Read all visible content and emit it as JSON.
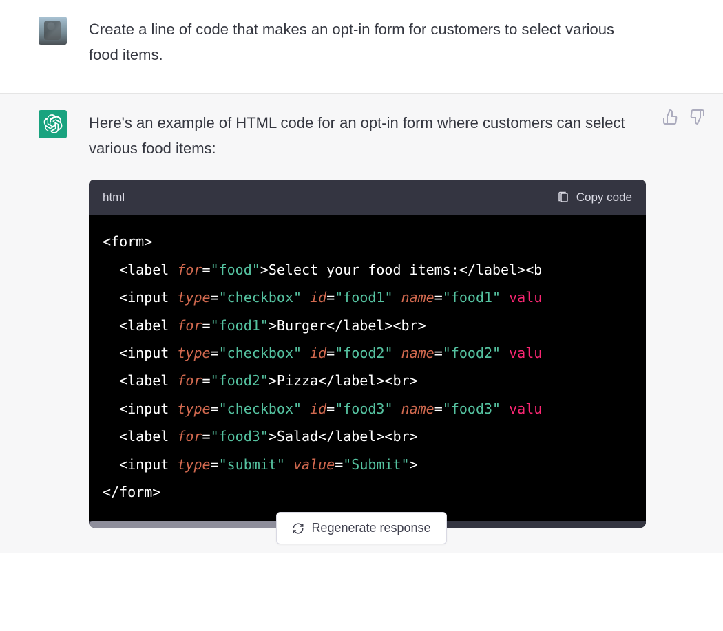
{
  "user": {
    "text": "Create a line of code that makes an opt-in form for customers to select various food items."
  },
  "assistant": {
    "intro": "Here's an example of HTML code for an opt-in form where customers can select various food items:",
    "code_lang": "html",
    "copy_label": "Copy code",
    "code_tokens": [
      [
        {
          "t": "t-tag",
          "v": "<form>"
        }
      ],
      [
        {
          "t": "indent",
          "v": "  "
        },
        {
          "t": "t-tag",
          "v": "<label "
        },
        {
          "t": "t-attr",
          "v": "for"
        },
        {
          "t": "t-tag",
          "v": "="
        },
        {
          "t": "t-str",
          "v": "\"food\""
        },
        {
          "t": "t-tag",
          "v": ">Select your food items:</label><b"
        }
      ],
      [
        {
          "t": "indent",
          "v": "  "
        },
        {
          "t": "t-tag",
          "v": "<input "
        },
        {
          "t": "t-attr",
          "v": "type"
        },
        {
          "t": "t-tag",
          "v": "="
        },
        {
          "t": "t-str",
          "v": "\"checkbox\""
        },
        {
          "t": "t-tag",
          "v": " "
        },
        {
          "t": "t-attr",
          "v": "id"
        },
        {
          "t": "t-tag",
          "v": "="
        },
        {
          "t": "t-str",
          "v": "\"food1\""
        },
        {
          "t": "t-tag",
          "v": " "
        },
        {
          "t": "t-attr",
          "v": "name"
        },
        {
          "t": "t-tag",
          "v": "="
        },
        {
          "t": "t-str",
          "v": "\"food1\""
        },
        {
          "t": "t-tag",
          "v": " "
        },
        {
          "t": "t-val",
          "v": "valu"
        }
      ],
      [
        {
          "t": "indent",
          "v": "  "
        },
        {
          "t": "t-tag",
          "v": "<label "
        },
        {
          "t": "t-attr",
          "v": "for"
        },
        {
          "t": "t-tag",
          "v": "="
        },
        {
          "t": "t-str",
          "v": "\"food1\""
        },
        {
          "t": "t-tag",
          "v": ">Burger</label><br>"
        }
      ],
      [
        {
          "t": "indent",
          "v": "  "
        },
        {
          "t": "t-tag",
          "v": "<input "
        },
        {
          "t": "t-attr",
          "v": "type"
        },
        {
          "t": "t-tag",
          "v": "="
        },
        {
          "t": "t-str",
          "v": "\"checkbox\""
        },
        {
          "t": "t-tag",
          "v": " "
        },
        {
          "t": "t-attr",
          "v": "id"
        },
        {
          "t": "t-tag",
          "v": "="
        },
        {
          "t": "t-str",
          "v": "\"food2\""
        },
        {
          "t": "t-tag",
          "v": " "
        },
        {
          "t": "t-attr",
          "v": "name"
        },
        {
          "t": "t-tag",
          "v": "="
        },
        {
          "t": "t-str",
          "v": "\"food2\""
        },
        {
          "t": "t-tag",
          "v": " "
        },
        {
          "t": "t-val",
          "v": "valu"
        }
      ],
      [
        {
          "t": "indent",
          "v": "  "
        },
        {
          "t": "t-tag",
          "v": "<label "
        },
        {
          "t": "t-attr",
          "v": "for"
        },
        {
          "t": "t-tag",
          "v": "="
        },
        {
          "t": "t-str",
          "v": "\"food2\""
        },
        {
          "t": "t-tag",
          "v": ">Pizza</label><br>"
        }
      ],
      [
        {
          "t": "indent",
          "v": "  "
        },
        {
          "t": "t-tag",
          "v": "<input "
        },
        {
          "t": "t-attr",
          "v": "type"
        },
        {
          "t": "t-tag",
          "v": "="
        },
        {
          "t": "t-str",
          "v": "\"checkbox\""
        },
        {
          "t": "t-tag",
          "v": " "
        },
        {
          "t": "t-attr",
          "v": "id"
        },
        {
          "t": "t-tag",
          "v": "="
        },
        {
          "t": "t-str",
          "v": "\"food3\""
        },
        {
          "t": "t-tag",
          "v": " "
        },
        {
          "t": "t-attr",
          "v": "name"
        },
        {
          "t": "t-tag",
          "v": "="
        },
        {
          "t": "t-str",
          "v": "\"food3\""
        },
        {
          "t": "t-tag",
          "v": " "
        },
        {
          "t": "t-val",
          "v": "valu"
        }
      ],
      [
        {
          "t": "indent",
          "v": "  "
        },
        {
          "t": "t-tag",
          "v": "<label "
        },
        {
          "t": "t-attr",
          "v": "for"
        },
        {
          "t": "t-tag",
          "v": "="
        },
        {
          "t": "t-str",
          "v": "\"food3\""
        },
        {
          "t": "t-tag",
          "v": ">Salad</label><br>"
        }
      ],
      [
        {
          "t": "indent",
          "v": "  "
        },
        {
          "t": "t-tag",
          "v": "<input "
        },
        {
          "t": "t-attr",
          "v": "type"
        },
        {
          "t": "t-tag",
          "v": "="
        },
        {
          "t": "t-str",
          "v": "\"submit\""
        },
        {
          "t": "t-tag",
          "v": " "
        },
        {
          "t": "t-attr",
          "v": "value"
        },
        {
          "t": "t-tag",
          "v": "="
        },
        {
          "t": "t-str",
          "v": "\"Submit\""
        },
        {
          "t": "t-tag",
          "v": ">"
        }
      ],
      [
        {
          "t": "t-tag",
          "v": "</form>"
        }
      ]
    ]
  },
  "regenerate_label": "Regenerate response"
}
